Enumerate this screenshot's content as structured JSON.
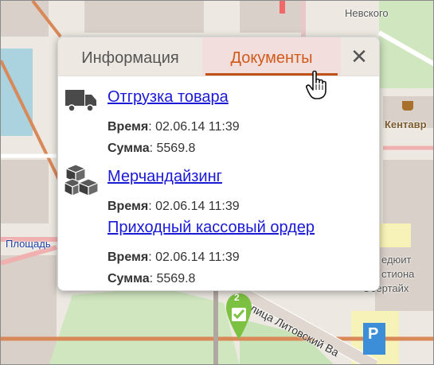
{
  "map": {
    "labels": {
      "district_top": "Невского",
      "cafe": "Кентавр",
      "square": "Площадь",
      "right_1": "едюит",
      "right_2": "стиона",
      "right_3": "Обертайх",
      "street": "лица Литовский Ва"
    },
    "marker": {
      "count": "2"
    },
    "parking_symbol": "P"
  },
  "popup": {
    "tabs": [
      {
        "label": "Информация",
        "active": false
      },
      {
        "label": "Документы",
        "active": true
      }
    ],
    "close_glyph": "✕",
    "documents": [
      {
        "title": "Отгрузка товара",
        "icon": "truck-icon",
        "time_label": "Время",
        "time_value": ": 02.06.14 11:39",
        "sum_label": "Сумма",
        "sum_value": ": 5569.8"
      },
      {
        "title": "Мерчандайзинг",
        "icon": "boxes-icon",
        "time_label": "Время",
        "time_value": ": 02.06.14 11:39"
      },
      {
        "title": "Приходный кассовый ордер",
        "icon": "",
        "time_label": "Время",
        "time_value": ": 02.06.14 11:39",
        "sum_label": "Сумма",
        "sum_value": ": 5569.8"
      }
    ]
  },
  "colors": {
    "accent": "#cf5a1a",
    "link": "#1a1ad6",
    "marker": "#7cc142"
  }
}
